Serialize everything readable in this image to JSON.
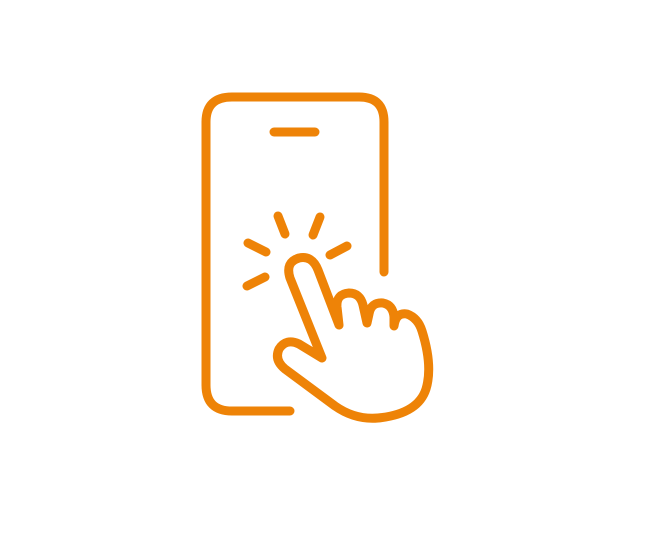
{
  "icon": {
    "name": "phone-tap-icon",
    "color": "#EE8307",
    "background": "#FFFFFF"
  }
}
